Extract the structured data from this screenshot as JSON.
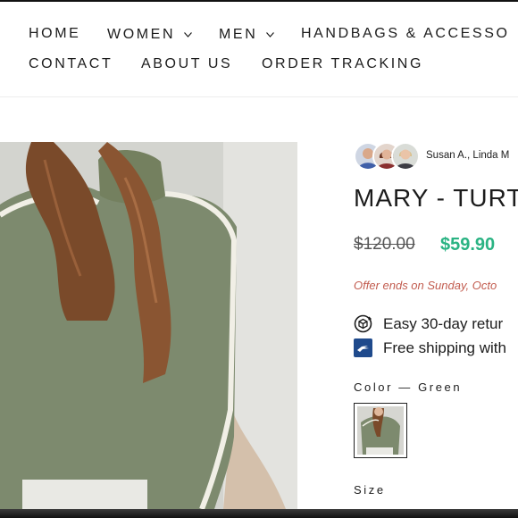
{
  "nav": {
    "row1": [
      {
        "label": "HOME",
        "has_dropdown": false
      },
      {
        "label": "WOMEN",
        "has_dropdown": true
      },
      {
        "label": "MEN",
        "has_dropdown": true
      },
      {
        "label": "HANDBAGS & ACCESSO",
        "has_dropdown": false
      }
    ],
    "row2": [
      {
        "label": "CONTACT"
      },
      {
        "label": "ABOUT US"
      },
      {
        "label": "ORDER TRACKING"
      }
    ],
    "dropdown_icon": "chevron-down-icon"
  },
  "product": {
    "gallery_image": "green-turtleneck-sweater-photo",
    "reviewers_text": "Susan A., Linda M",
    "title": "MARY - TURT",
    "price_original": "$120.00",
    "price_sale": "$59.90",
    "offer_text": "Offer ends on Sunday, Octo",
    "features": [
      {
        "icon": "return-box-icon",
        "text": "Easy 30-day retur"
      },
      {
        "icon": "shipping-eagle-icon",
        "text": "Free shipping with"
      }
    ],
    "color_label": "Color — Green",
    "size_label": "Size"
  },
  "colors": {
    "sale_price": "#2ab383",
    "offer_text": "#c25c4f",
    "sweater": "#7d8a6e",
    "hair": "#7a4a2a"
  }
}
